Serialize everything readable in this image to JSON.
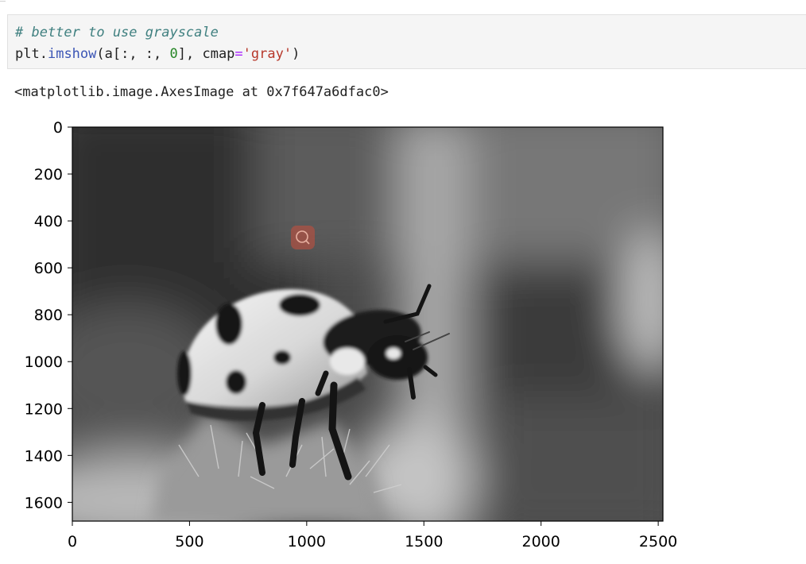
{
  "cell": {
    "comment": "# better to use grayscale",
    "code_obj": "plt",
    "code_dot": ".",
    "code_fn": "imshow",
    "code_open": "(a[:, :, ",
    "code_index": "0",
    "code_mid": "], cmap",
    "code_eq": "=",
    "code_str": "'gray'",
    "code_close": ")"
  },
  "output": {
    "repr": "<matplotlib.image.AxesImage at 0x7f647a6dfac0>"
  },
  "colors": {
    "code_bg": "#f5f5f5",
    "comment": "#408080",
    "function": "#3b55b5",
    "number": "#268626",
    "string": "#b7382b",
    "operator": "#aa22ff",
    "overlay_icon": "#b85040"
  },
  "chart_data": {
    "type": "image",
    "colormap": "gray",
    "subject": "ladybug on a thistle bud",
    "xlim": [
      0,
      2520
    ],
    "ylim": [
      1680,
      0
    ],
    "x_ticks": [
      0,
      500,
      1000,
      1500,
      2000,
      2500
    ],
    "y_ticks": [
      0,
      200,
      400,
      600,
      800,
      1000,
      1200,
      1400,
      1600
    ],
    "x_tick_labels": [
      "0",
      "500",
      "1000",
      "1500",
      "2000",
      "2500"
    ],
    "y_tick_labels": [
      "0",
      "200",
      "400",
      "600",
      "800",
      "1000",
      "1200",
      "1400",
      "1600"
    ],
    "grid": false,
    "overlay": {
      "icon": "search-icon",
      "x": 975,
      "y": 470
    }
  }
}
